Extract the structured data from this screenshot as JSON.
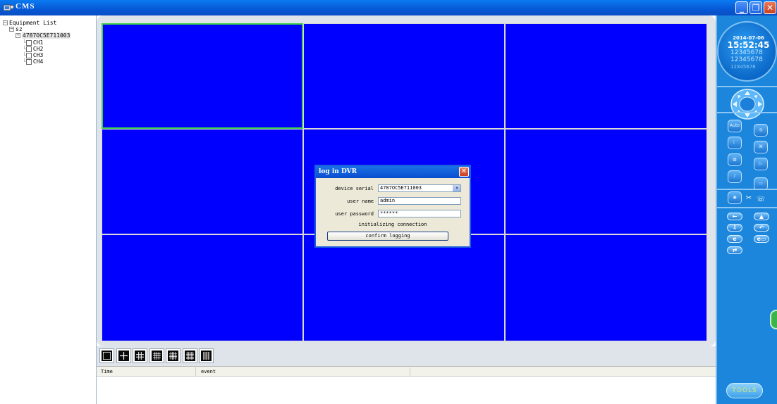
{
  "window": {
    "title": "CMS",
    "minimize_label": "_",
    "maximize_label": "❐",
    "close_label": "✕"
  },
  "tree": {
    "root_label": "Equipment List",
    "group_label": "sz",
    "device_label": "4787OC5E711003",
    "channels": [
      "CH1",
      "CH2",
      "CH3",
      "CH4"
    ]
  },
  "video_grid": {
    "rows": 3,
    "cols": 3,
    "selected_cell": 0,
    "background_color": "#0000ff"
  },
  "layout_buttons": [
    "1x1",
    "2x2",
    "3x3",
    "4x4",
    "5x5",
    "6x6",
    "8x8"
  ],
  "event_table": {
    "columns": [
      "Time",
      "event"
    ]
  },
  "right_panel": {
    "date": "2014-07-06",
    "time": "15:52:45",
    "serial_lines": [
      "12345678",
      "12345678",
      "12345678"
    ],
    "tools_label": "TOOLS",
    "ptz_buttons": [
      "Auto"
    ]
  },
  "dialog": {
    "title": "log in DVR",
    "close_label": "✕",
    "device_serial_label": "device serial",
    "device_serial_value": "4787OC5E711003",
    "user_name_label": "user name",
    "user_name_value": "admin",
    "user_password_label": "user password",
    "user_password_value": "******",
    "status_text": "initializing connection",
    "confirm_label": "confirm logging"
  }
}
